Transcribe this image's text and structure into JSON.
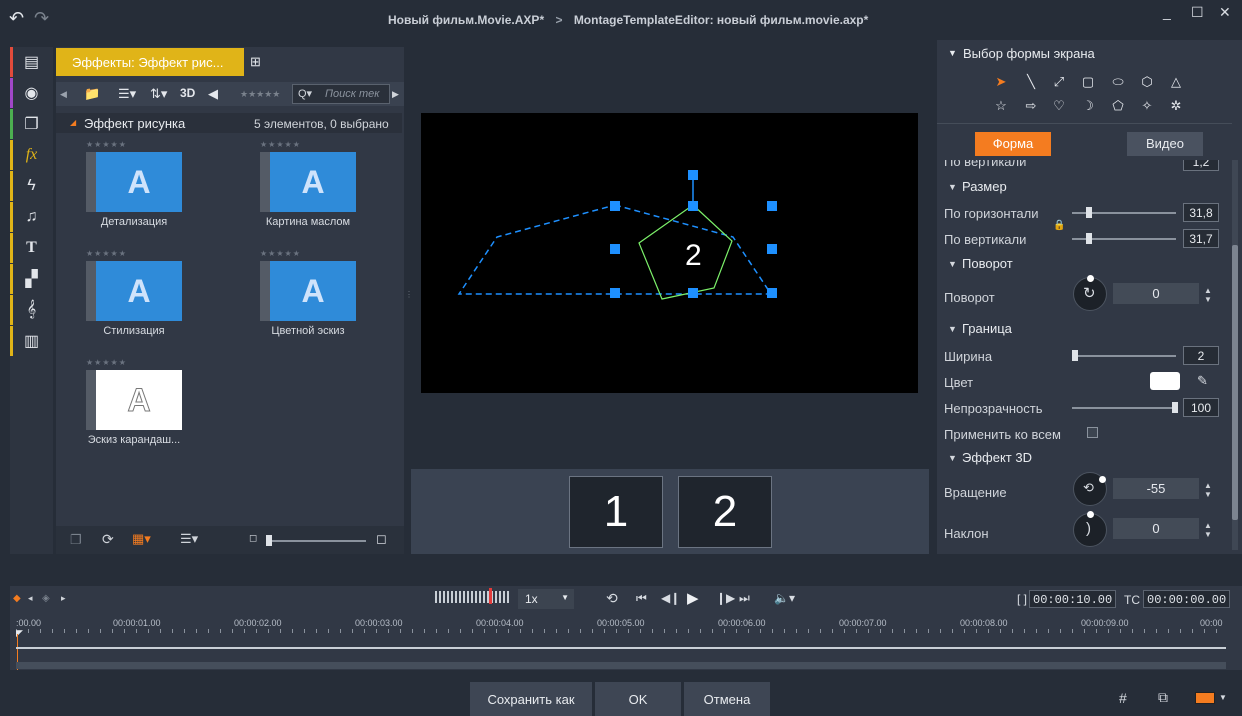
{
  "title": {
    "project": "Новый фильм.Movie.AXP",
    "project_mark": "*",
    "separator": ">",
    "editor": "MontageTemplateEditor: новый фильм.movie.axp",
    "editor_mark": "*"
  },
  "window": {
    "minimize": "_",
    "maximize": "☐",
    "close": "✕"
  },
  "library": {
    "tab_label": "Эффекты: Эффект рис...",
    "toolbar_3d": "3D",
    "search_placeholder": "Поиск тек",
    "folder_name": "Эффект рисунка",
    "folder_count": "5 элементов, 0 выбрано",
    "items": [
      {
        "label": "Детализация",
        "glyph": "A"
      },
      {
        "label": "Картина маслом",
        "glyph": "A"
      },
      {
        "label": "Стилизация",
        "glyph": "A"
      },
      {
        "label": "Цветной эскиз",
        "glyph": "A"
      },
      {
        "label": "Эскиз карандаш...",
        "glyph": "A"
      }
    ],
    "stars": "★★★★★"
  },
  "preview": {
    "shape_number": "2"
  },
  "filmstrip": {
    "frames": [
      "1",
      "2"
    ]
  },
  "shape_panel": {
    "title": "Выбор формы экрана",
    "tab_shape": "Форма",
    "tab_video": "Видео",
    "partial_label": "По вертикали",
    "partial_value": "1,2",
    "size_section": "Размер",
    "size_h_label": "По горизонтали",
    "size_h_value": "31,8",
    "size_v_label": "По вертикали",
    "size_v_value": "31,7",
    "rotation_section": "Поворот",
    "rotation_label": "Поворот",
    "rotation_value": "0",
    "border_section": "Граница",
    "width_label": "Ширина",
    "width_value": "2",
    "color_label": "Цвет",
    "opacity_label": "Непрозрачность",
    "opacity_value": "100",
    "apply_all_label": "Применить ко всем",
    "effect3d_section": "Эффект 3D",
    "spin_label": "Вращение",
    "spin_value": "-55",
    "tilt_label": "Наклон",
    "tilt_value": "0",
    "border_color": "#ffffff"
  },
  "timeline": {
    "speed": "1x",
    "bracket": "[ ]",
    "duration": "00:00:10.00",
    "tc_label": "TC",
    "timecode": "00:00:00.00",
    "ticks": [
      ":00.00",
      "00:00:01.00",
      "00:00:02.00",
      "00:00:03.00",
      "00:00:04.00",
      "00:00:05.00",
      "00:00:06.00",
      "00:00:07.00",
      "00:00:08.00",
      "00:00:09.00",
      "00:00"
    ]
  },
  "buttons": {
    "save_as": "Сохранить как",
    "ok": "OK",
    "cancel": "Отмена"
  },
  "colors": {
    "accent": "#f47c20",
    "tab_yellow": "#e0b418",
    "selection_blue": "#1e90ff",
    "shape_green": "#7cf06a"
  }
}
